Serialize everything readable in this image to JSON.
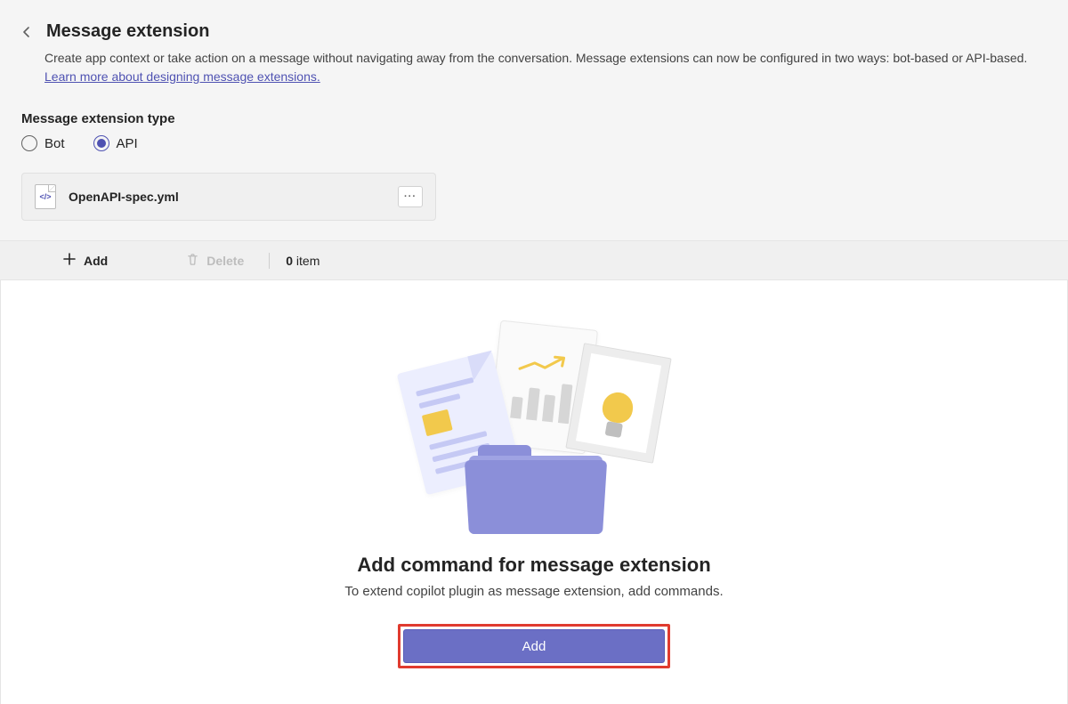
{
  "header": {
    "title": "Message extension",
    "description_prefix": "Create app context or take action on a message without navigating away from the conversation. Message extensions can now be configured in two ways: bot-based or API-based. ",
    "link_text": "Learn more about designing message extensions."
  },
  "type_section": {
    "label": "Message extension type",
    "options": {
      "bot": "Bot",
      "api": "API"
    },
    "selected": "api"
  },
  "file": {
    "name": "OpenAPI-spec.yml",
    "icon_text": "</>"
  },
  "toolbar": {
    "add_label": "Add",
    "delete_label": "Delete",
    "count_number": "0",
    "count_suffix": " item"
  },
  "empty_state": {
    "title": "Add command for message extension",
    "subtitle": "To extend copilot plugin as message extension, add commands.",
    "button_label": "Add"
  }
}
